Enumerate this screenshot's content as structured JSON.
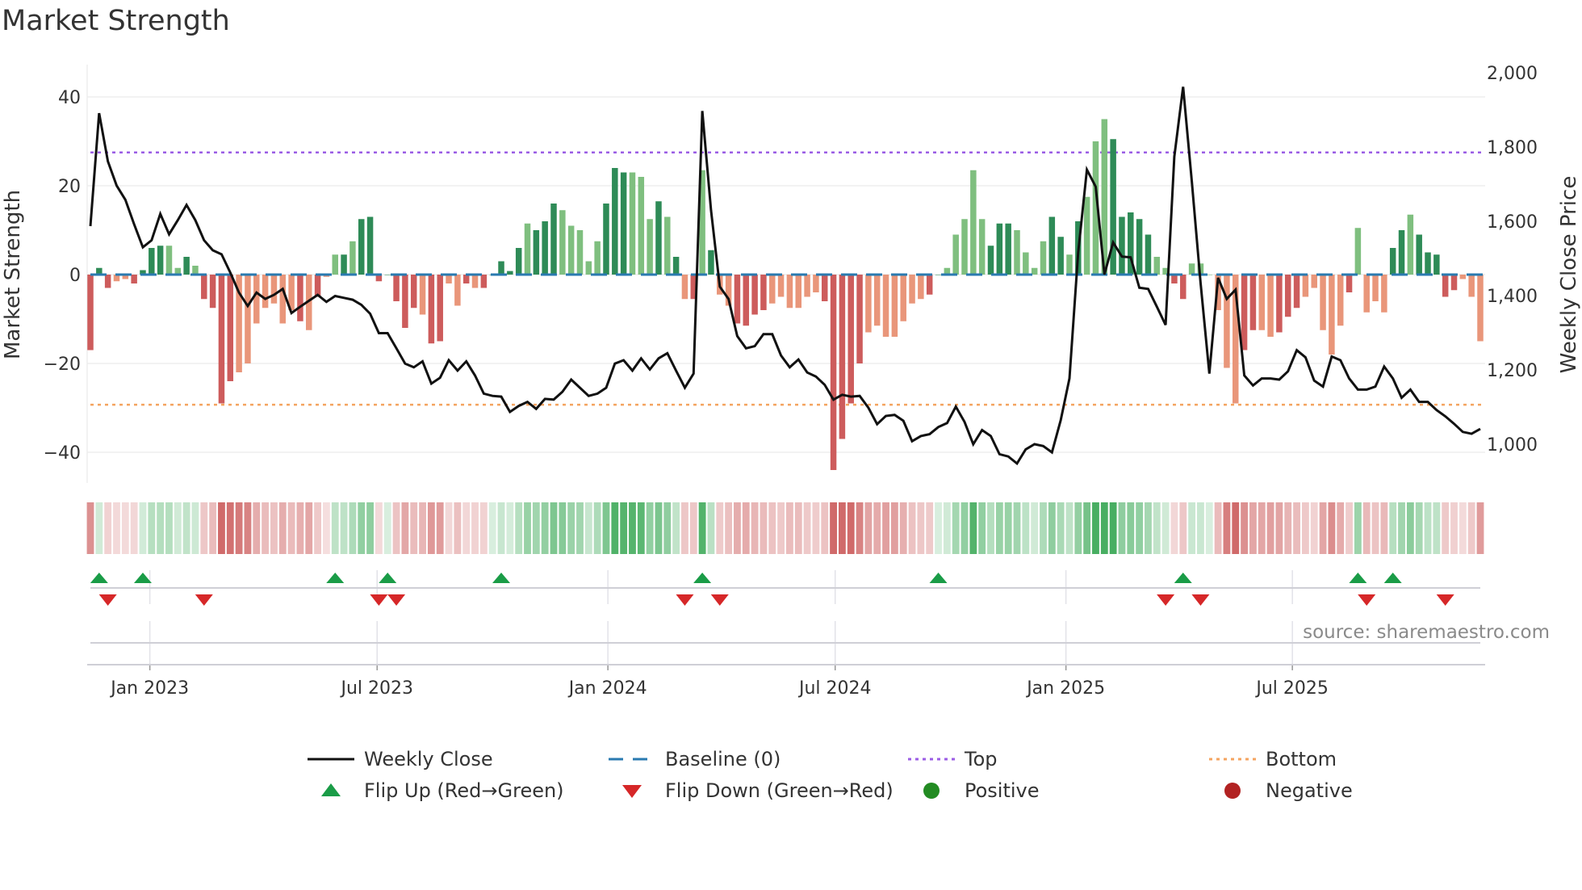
{
  "chart_data": {
    "type": "bar",
    "title": "Market Strength",
    "ylabel": "Market Strength",
    "y2label": "Weekly Close Price",
    "ylim": [
      -47,
      51
    ],
    "y2lim": [
      950,
      2040
    ],
    "yticks": [
      {
        "v": 40,
        "label": "40"
      },
      {
        "v": 20,
        "label": "20"
      },
      {
        "v": 0,
        "label": "0"
      },
      {
        "v": -20,
        "label": "−20"
      },
      {
        "v": -40,
        "label": "−40"
      }
    ],
    "y2ticks": [
      {
        "v": 2000,
        "label": "2,000"
      },
      {
        "v": 1800,
        "label": "1,800"
      },
      {
        "v": 1600,
        "label": "1,600"
      },
      {
        "v": 1400,
        "label": "1,400"
      },
      {
        "v": 1200,
        "label": "1,200"
      },
      {
        "v": 1000,
        "label": "1,000"
      }
    ],
    "x_ticks": [
      {
        "label": "Jan 2023",
        "week": 6.8
      },
      {
        "label": "Jul 2023",
        "week": 32.8
      },
      {
        "label": "Jan 2024",
        "week": 59.2
      },
      {
        "label": "Jul 2024",
        "week": 85.2
      },
      {
        "label": "Jan 2025",
        "week": 111.6
      },
      {
        "label": "Jul 2025",
        "week": 137.5
      }
    ],
    "top_level": 27.5,
    "bottom_level": -29.3,
    "baseline": 0,
    "strength": [
      -17,
      1.5,
      -3,
      -1.5,
      -1,
      -2,
      1,
      6,
      6.5,
      6.5,
      1.5,
      4,
      2,
      -5.5,
      -7.5,
      -29,
      -24,
      -22,
      -20,
      -11,
      -7.5,
      -6.5,
      -11,
      -8,
      -10.5,
      -12.5,
      -5,
      -0.5,
      4.5,
      4.5,
      7.5,
      12.5,
      13,
      -1.5,
      0,
      -6,
      -12,
      -7.5,
      -9,
      -15.5,
      -15,
      -2,
      -7,
      -2,
      -3,
      -3,
      0,
      3,
      0.8,
      6,
      11.5,
      10,
      12,
      16,
      14.5,
      11,
      10,
      3,
      7.5,
      16,
      24,
      23,
      23,
      22,
      12.5,
      16.5,
      13,
      4,
      -5.5,
      -5.5,
      23.5,
      5.5,
      -4.5,
      -7,
      -11,
      -11.5,
      -9,
      -8,
      -6.5,
      -5,
      -7.5,
      -7.5,
      -5,
      -4,
      -6,
      -44,
      -37,
      -29,
      -20,
      -13,
      -11.5,
      -14,
      -14,
      -10.5,
      -6.5,
      -5.5,
      -4.5,
      0,
      1.5,
      9,
      12.5,
      23.5,
      12.5,
      6.5,
      11.5,
      11.5,
      10,
      5,
      1.5,
      7.5,
      13,
      8.5,
      4.5,
      12,
      17.5,
      30,
      35,
      30.5,
      13,
      14,
      12.5,
      9,
      4,
      1.5,
      -2,
      -5.5,
      2.5,
      2.5,
      0,
      -8,
      -21,
      -29,
      -17,
      -12.5,
      -12.5,
      -14,
      -13,
      -9.5,
      -7.5,
      -5,
      -3,
      -12.5,
      -18,
      -11.5,
      -4,
      10.5,
      -8.5,
      -6,
      -8.5,
      6,
      10,
      13.5,
      9,
      5,
      4.5,
      -5,
      -3.5,
      -1,
      -5,
      -15
    ],
    "bar_shade": "dddllddddlldlddddllllllldldlldldddddddlddlldldddddldddllllldddllldldldldllddddlllllldddddlllllllddllllldddllllddldllldddddllddllllllddlldddllllldllllddldddddlllllldldddlllldldd",
    "close": [
      1587,
      1891,
      1761,
      1696,
      1658,
      1592,
      1530,
      1549,
      1620,
      1565,
      1603,
      1644,
      1603,
      1549,
      1522,
      1511,
      1462,
      1408,
      1372,
      1408,
      1391,
      1402,
      1418,
      1353,
      1370,
      1386,
      1402,
      1383,
      1399,
      1394,
      1389,
      1375,
      1351,
      1299,
      1299,
      1258,
      1217,
      1207,
      1223,
      1163,
      1179,
      1226,
      1198,
      1223,
      1185,
      1136,
      1130,
      1128,
      1087,
      1103,
      1114,
      1095,
      1122,
      1120,
      1141,
      1174,
      1152,
      1130,
      1136,
      1152,
      1217,
      1226,
      1198,
      1231,
      1201,
      1231,
      1245,
      1198,
      1152,
      1190,
      1897,
      1630,
      1424,
      1391,
      1291,
      1258,
      1264,
      1296,
      1296,
      1239,
      1207,
      1228,
      1193,
      1182,
      1160,
      1120,
      1133,
      1128,
      1130,
      1098,
      1054,
      1076,
      1079,
      1063,
      1008,
      1022,
      1027,
      1046,
      1057,
      1101,
      1060,
      1000,
      1038,
      1022,
      973,
      967,
      948,
      986,
      1000,
      995,
      978,
      1065,
      1177,
      1516,
      1739,
      1693,
      1457,
      1543,
      1505,
      1503,
      1421,
      1418,
      1370,
      1321,
      1774,
      1962,
      1707,
      1435,
      1190,
      1448,
      1391,
      1416,
      1185,
      1158,
      1177,
      1177,
      1174,
      1196,
      1253,
      1234,
      1171,
      1155,
      1236,
      1226,
      1177,
      1147,
      1147,
      1155,
      1209,
      1177,
      1125,
      1147,
      1114,
      1114,
      1092,
      1075,
      1055,
      1033,
      1028,
      1041
    ],
    "flip_up_weeks": [
      1,
      6,
      28,
      34,
      47,
      70,
      97,
      125,
      145,
      149
    ],
    "flip_down_weeks": [
      2,
      13,
      33,
      35,
      68,
      72,
      123,
      127,
      146,
      155
    ],
    "legend": {
      "placement": "bottom",
      "items": [
        {
          "label": "Weekly Close",
          "kind": "line"
        },
        {
          "label": "Baseline (0)",
          "kind": "dash"
        },
        {
          "label": "Top",
          "kind": "dot-top"
        },
        {
          "label": "Bottom",
          "kind": "dot-bottom"
        },
        {
          "label": "Flip Up (Red→Green)",
          "kind": "tri-up"
        },
        {
          "label": "Flip Down (Green→Red)",
          "kind": "tri-down"
        },
        {
          "label": "Positive",
          "kind": "dot-pos"
        },
        {
          "label": "Negative",
          "kind": "dot-neg"
        }
      ]
    },
    "source": "source: sharemaestro.com",
    "colors": {
      "pos_strong": "#2e8b57",
      "pos_weak": "#7fbf7f",
      "neg_strong": "#cd5c5c",
      "neg_weak": "#e9967a",
      "close": "#111111",
      "baseline": "#2a7ab0",
      "top": "#9b5de5",
      "bottom": "#f4a460",
      "flip_up": "#1a9c47",
      "flip_down": "#d62728",
      "positive": "#228b22",
      "negative": "#b22222"
    }
  }
}
